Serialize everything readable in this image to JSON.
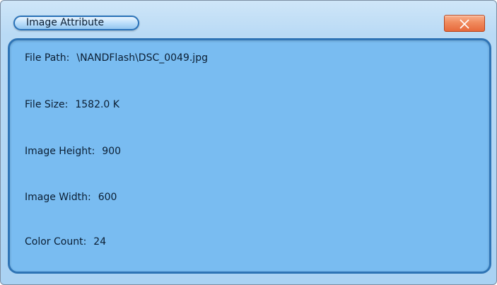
{
  "dialog": {
    "title": "Image Attribute",
    "close_icon": "close-icon"
  },
  "attributes": {
    "file_path": {
      "label": "File Path:",
      "value": "\\NANDFlash\\DSC_0049.jpg"
    },
    "file_size": {
      "label": "File Size:",
      "value": "1582.0 K"
    },
    "image_height": {
      "label": "Image Height:",
      "value": "900"
    },
    "image_width": {
      "label": "Image Width:",
      "value": "600"
    },
    "color_count": {
      "label": "Color Count:",
      "value": "24"
    }
  },
  "colors": {
    "panel_fill": "#79bcf1",
    "panel_border": "#2f74b5",
    "close_button": "#f08a5d"
  }
}
